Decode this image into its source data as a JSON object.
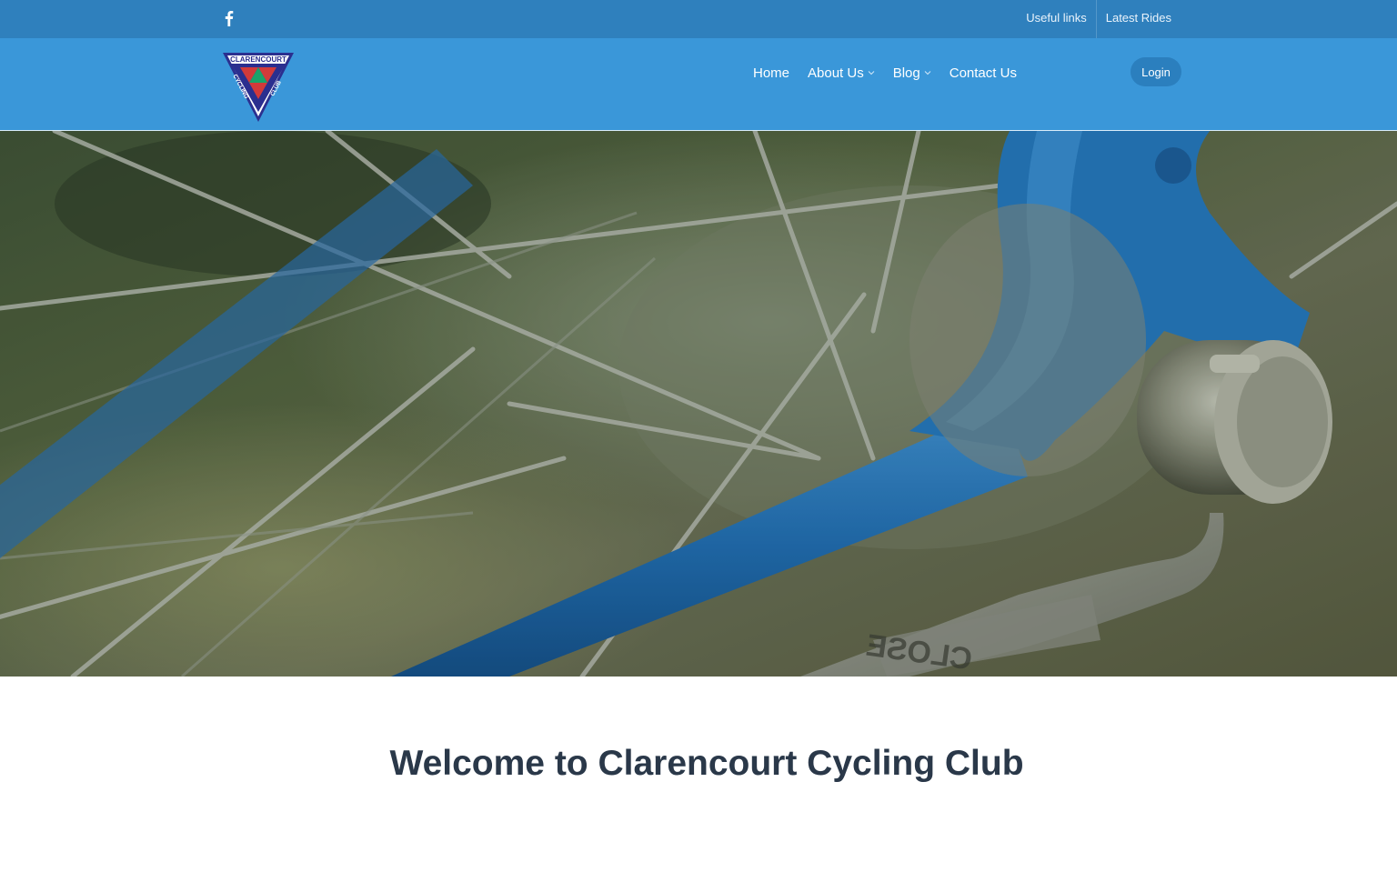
{
  "topbar": {
    "social_icon": "facebook-icon",
    "links": [
      {
        "label": "Useful links"
      },
      {
        "label": "Latest Rides"
      }
    ]
  },
  "header": {
    "logo": {
      "icon": "clarencourt-cycling-club-logo",
      "text_top": "CLARENCOURT",
      "text_left": "CYCLING",
      "text_right": "CLUB"
    },
    "nav": [
      {
        "label": "Home",
        "dropdown": false
      },
      {
        "label": "About Us",
        "dropdown": true
      },
      {
        "label": "Blog",
        "dropdown": true
      },
      {
        "label": "Contact Us",
        "dropdown": false
      }
    ],
    "login_label": "Login"
  },
  "hero": {
    "image": "bicycle-wheel-hub-photo",
    "image_text": "CLOSE"
  },
  "main": {
    "title": "Welcome to Clarencourt Cycling Club"
  },
  "colors": {
    "topbar": "#2f80bd",
    "navbar": "#3a97d9",
    "login_button": "#2b7fbe",
    "title": "#2a3849"
  }
}
